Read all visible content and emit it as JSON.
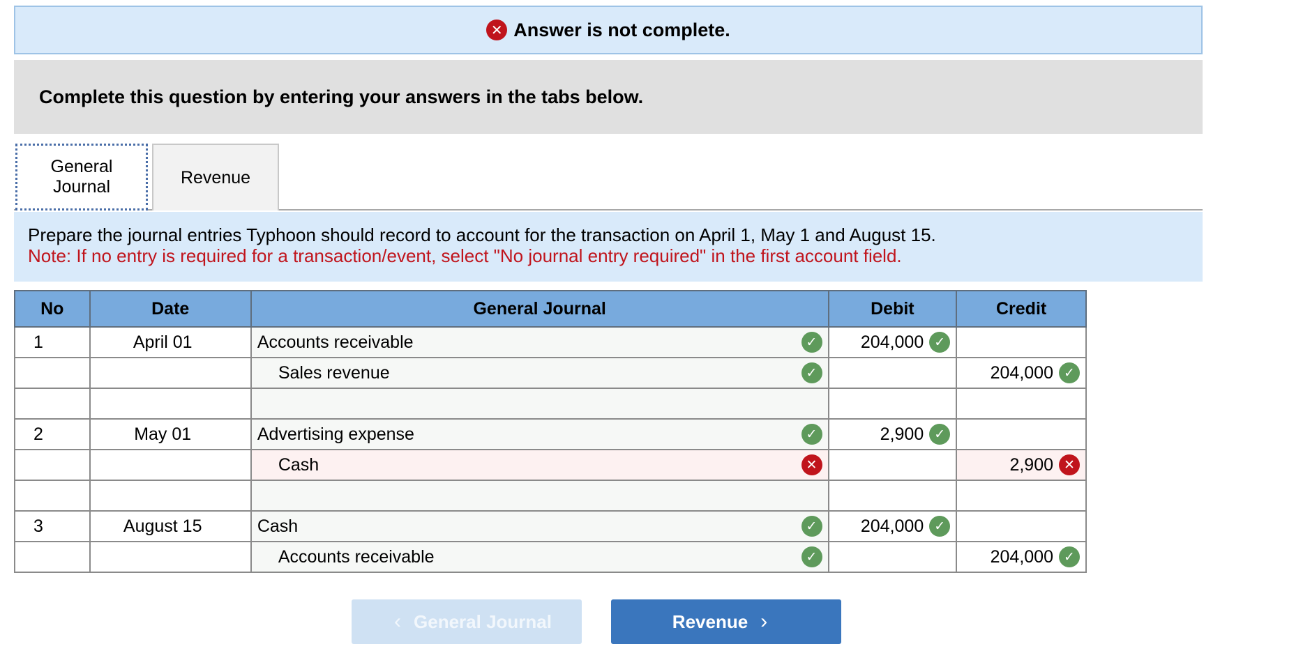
{
  "status": {
    "text": "Answer is not complete.",
    "icon": "x-circle-icon",
    "color": "#c0141c"
  },
  "instruction": "Complete this question by entering your answers in the tabs below.",
  "tabs": [
    {
      "label": "General Journal",
      "active": true
    },
    {
      "label": "Revenue",
      "active": false
    }
  ],
  "prompt": {
    "text": "Prepare the journal entries Typhoon should record to account for the transaction on April 1, May 1 and August 15.",
    "note": "Note: If no entry is required for a transaction/event, select \"No journal entry required\" in the first account field."
  },
  "table": {
    "headers": [
      "No",
      "Date",
      "General Journal",
      "Debit",
      "Credit"
    ],
    "rows": [
      {
        "no": "1",
        "date": "April 01",
        "account": "Accounts receivable",
        "indent": false,
        "account_status": "correct",
        "debit": "204,000",
        "debit_status": "correct",
        "credit": "",
        "credit_status": ""
      },
      {
        "no": "",
        "date": "",
        "account": "Sales revenue",
        "indent": true,
        "account_status": "correct",
        "debit": "",
        "debit_status": "",
        "credit": "204,000",
        "credit_status": "correct"
      },
      {
        "no": "",
        "date": "",
        "account": "",
        "indent": false,
        "account_status": "",
        "debit": "",
        "debit_status": "",
        "credit": "",
        "credit_status": ""
      },
      {
        "no": "2",
        "date": "May 01",
        "account": "Advertising expense",
        "indent": false,
        "account_status": "correct",
        "debit": "2,900",
        "debit_status": "correct",
        "credit": "",
        "credit_status": ""
      },
      {
        "no": "",
        "date": "",
        "account": "Cash",
        "indent": true,
        "account_status": "incorrect",
        "debit": "",
        "debit_status": "",
        "credit": "2,900",
        "credit_status": "incorrect"
      },
      {
        "no": "",
        "date": "",
        "account": "",
        "indent": false,
        "account_status": "",
        "debit": "",
        "debit_status": "",
        "credit": "",
        "credit_status": ""
      },
      {
        "no": "3",
        "date": "August 15",
        "account": "Cash",
        "indent": false,
        "account_status": "correct",
        "debit": "204,000",
        "debit_status": "correct",
        "credit": "",
        "credit_status": ""
      },
      {
        "no": "",
        "date": "",
        "account": "Accounts receivable",
        "indent": true,
        "account_status": "correct",
        "debit": "",
        "debit_status": "",
        "credit": "204,000",
        "credit_status": "correct"
      }
    ]
  },
  "nav": {
    "prev_label": "General Journal",
    "next_label": "Revenue"
  },
  "colors": {
    "correct": "#5e9a5b",
    "incorrect": "#c0141c",
    "header": "#78aadd",
    "primary_button": "#3a76bd"
  }
}
